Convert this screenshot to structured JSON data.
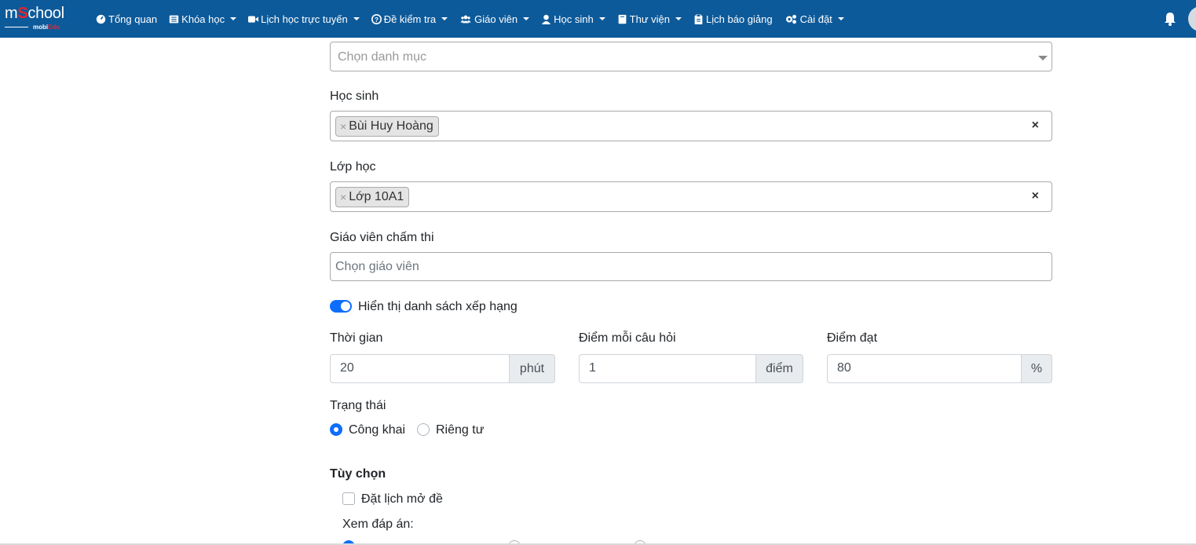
{
  "brand": {
    "name_part1": "m",
    "name_s": "S",
    "name_part2": "chool",
    "sub_part1": "mobi",
    "sub_part2": "Edu"
  },
  "nav": {
    "items": [
      {
        "label": "Tổng quan",
        "icon": "dashboard-icon",
        "dropdown": false
      },
      {
        "label": "Khóa học",
        "icon": "list-icon",
        "dropdown": true
      },
      {
        "label": "Lịch học trực tuyến",
        "icon": "video-icon",
        "dropdown": true
      },
      {
        "label": "Đề kiểm tra",
        "icon": "question-circle-icon",
        "dropdown": true
      },
      {
        "label": "Giáo viên",
        "icon": "users-icon",
        "dropdown": true
      },
      {
        "label": "Học sinh",
        "icon": "user-icon",
        "dropdown": true
      },
      {
        "label": "Thư viện",
        "icon": "book-icon",
        "dropdown": true
      },
      {
        "label": "Lịch báo giảng",
        "icon": "clipboard-icon",
        "dropdown": false
      },
      {
        "label": "Cài đặt",
        "icon": "gears-icon",
        "dropdown": true
      }
    ],
    "bell_icon": "bell-icon",
    "nav_color": "#0d5a9a"
  },
  "form": {
    "category": {
      "placeholder": "Chọn danh mục"
    },
    "students": {
      "label": "Học sinh",
      "tags": [
        "Bùi Huy Hoàng"
      ],
      "clear": "×",
      "tag_remove": "×"
    },
    "classes": {
      "label": "Lớp học",
      "tags": [
        "Lớp 10A1"
      ],
      "clear": "×",
      "tag_remove": "×"
    },
    "grader": {
      "label": "Giáo viên chấm thi",
      "placeholder": "Chọn giáo viên"
    },
    "ranking_toggle": {
      "label": "Hiển thị danh sách xếp hạng",
      "checked": true
    },
    "duration": {
      "label": "Thời gian",
      "value": "20",
      "unit": "phút"
    },
    "points_per_question": {
      "label": "Điểm mỗi câu hỏi",
      "value": "1",
      "unit": "điểm"
    },
    "pass_score": {
      "label": "Điểm đạt",
      "value": "80",
      "unit": "%"
    },
    "status": {
      "label": "Trạng thái",
      "options": [
        "Công khai",
        "Riêng tư"
      ],
      "selected": "Công khai"
    },
    "options": {
      "title": "Tùy chọn",
      "schedule": {
        "label": "Đặt lịch mở đề",
        "checked": false
      },
      "view_answers_label": "Xem đáp án:"
    },
    "accent_color": "#0d6efd"
  }
}
